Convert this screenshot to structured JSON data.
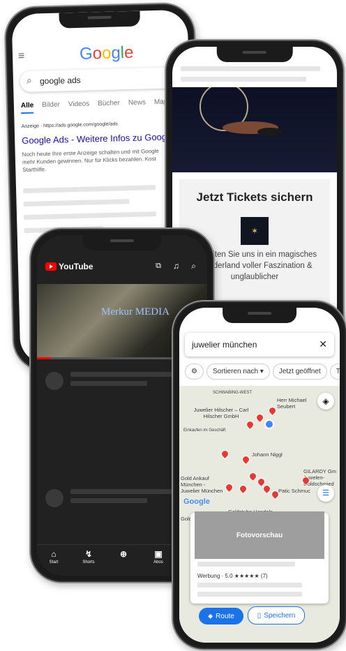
{
  "google": {
    "logo": "Google",
    "query": "google ads",
    "tabs": [
      "Alle",
      "Bilder",
      "Videos",
      "Bücher",
      "News",
      "Map"
    ],
    "ad_label": "Anzeige · https://ads.google.com/google/ads",
    "ad_title": "Google Ads - Weitere Infos zu Google",
    "ad_desc": "Noch heute Ihre erste Anzeige schalten und mit Google mehr Kunden gewinnen. Nur für Klicks bezahlen. Kost Starthilfe."
  },
  "ticket_ad": {
    "headline": "Jetzt Tickets sichern",
    "body": "Begleiten Sie uns in ein magisches Wunderland voller Faszination & unglaublicher"
  },
  "youtube": {
    "logo": "YouTube",
    "overlay": "Merkur MEDIA",
    "nav": [
      "Start",
      "Shorts",
      "",
      "Abos"
    ]
  },
  "maps": {
    "query": "juwelier münchen",
    "chips": [
      "Sortieren nach",
      "Jetzt geöffnet",
      "Top b"
    ],
    "places": [
      "SCHWABING-WEST",
      "Herr Michael Seubert",
      "Juwelier Hilscher – Carl Hilscher GmbH",
      "Einkaufen im Geschäft",
      "Johann Niggl",
      "GILARDY Gm Juwelen- Goldschmied",
      "Gold Ankauf München - Juwelier München",
      "Patic Schmuc",
      "Goldstube Handels",
      "Goldschmied",
      "Google"
    ],
    "preview": "Fotovorschau",
    "sponsor": "Werbung · 5.0 ★★★★★ (7)",
    "route": "Route",
    "save": "Speichern"
  },
  "colors": {
    "accent_blue": "#1a73e8",
    "youtube_red": "#ff0000",
    "pin_red": "#e53935"
  }
}
